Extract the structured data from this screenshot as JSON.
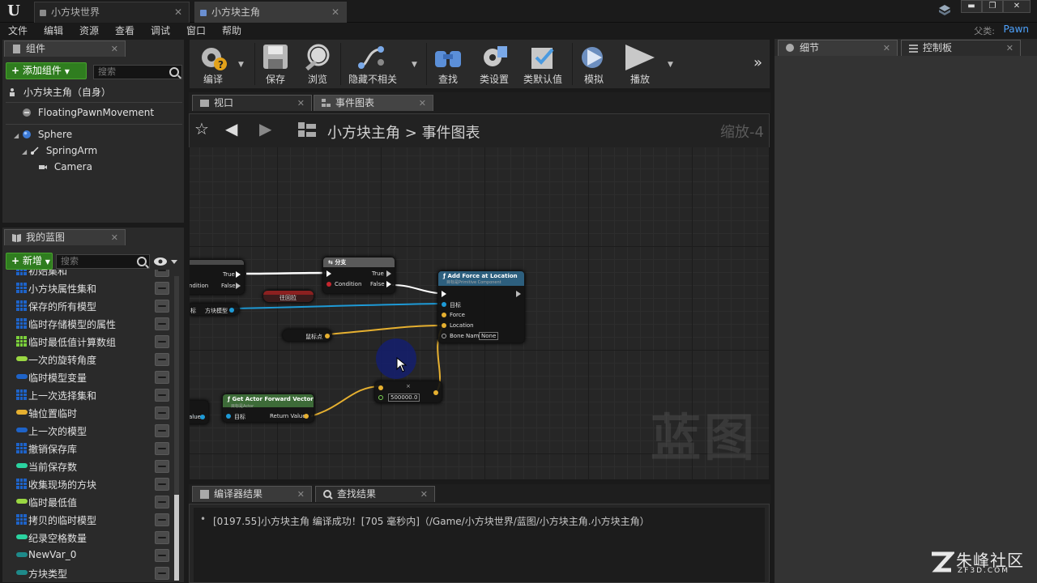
{
  "window": {
    "tabs": [
      {
        "label": "小方块世界",
        "active": false
      },
      {
        "label": "小方块主角",
        "active": true
      }
    ],
    "controls": [
      "▬",
      "❐",
      "✕"
    ]
  },
  "menu": {
    "items": [
      "文件",
      "编辑",
      "资源",
      "查看",
      "调试",
      "窗口",
      "帮助"
    ],
    "parent_label": "父类:",
    "parent_value": "Pawn"
  },
  "components": {
    "tab_label": "组件",
    "add_button": "添加组件",
    "search_placeholder": "搜索",
    "self_label": "小方块主角（自身）",
    "movement_component": "FloatingPawnMovement",
    "tree": [
      {
        "label": "Sphere",
        "icon": "sphere-icon"
      },
      {
        "label": "SpringArm",
        "icon": "springarm-icon"
      },
      {
        "label": "Camera",
        "icon": "camera-icon"
      }
    ]
  },
  "my_blueprint": {
    "tab_label": "我的蓝图",
    "new_button": "新增",
    "search_placeholder": "搜索",
    "variables": [
      {
        "label": "初始集和",
        "color": "#1e63c8",
        "kind": "grid"
      },
      {
        "label": "小方块属性集和",
        "color": "#1e63c8",
        "kind": "grid"
      },
      {
        "label": "保存的所有模型",
        "color": "#1e63c8",
        "kind": "grid"
      },
      {
        "label": "临时存储模型的属性",
        "color": "#1e63c8",
        "kind": "grid"
      },
      {
        "label": "临时最低值计算数组",
        "color": "#7bd03b",
        "kind": "grid"
      },
      {
        "label": "一次的旋转角度",
        "color": "#9ad742",
        "kind": "pill"
      },
      {
        "label": "临时模型变量",
        "color": "#1e63c8",
        "kind": "pill"
      },
      {
        "label": "上一次选择集和",
        "color": "#1e63c8",
        "kind": "grid"
      },
      {
        "label": "轴位置临时",
        "color": "#e6b030",
        "kind": "pill"
      },
      {
        "label": "上一次的模型",
        "color": "#1e63c8",
        "kind": "pill"
      },
      {
        "label": "撤销保存库",
        "color": "#1e63c8",
        "kind": "grid"
      },
      {
        "label": "当前保存数",
        "color": "#2ad3a0",
        "kind": "pill"
      },
      {
        "label": "收集现场的方块",
        "color": "#1e63c8",
        "kind": "grid"
      },
      {
        "label": "临时最低值",
        "color": "#9ad742",
        "kind": "pill"
      },
      {
        "label": "拷贝的临时模型",
        "color": "#1e63c8",
        "kind": "grid"
      },
      {
        "label": "纪录空格数量",
        "color": "#2ad3a0",
        "kind": "pill"
      },
      {
        "label": "NewVar_0",
        "color": "#1e8a8a",
        "kind": "pill"
      },
      {
        "label": "方块类型",
        "color": "#1e8a8a",
        "kind": "pill"
      }
    ]
  },
  "toolbar": {
    "buttons": [
      {
        "label": "编译",
        "icon": "compile-icon"
      },
      {
        "label": "保存",
        "icon": "save-icon"
      },
      {
        "label": "浏览",
        "icon": "browse-icon"
      },
      {
        "label": "隐藏不相关",
        "icon": "hide-unrelated-icon"
      },
      {
        "label": "查找",
        "icon": "find-icon"
      },
      {
        "label": "类设置",
        "icon": "class-settings-icon"
      },
      {
        "label": "类默认值",
        "icon": "class-defaults-icon"
      },
      {
        "label": "模拟",
        "icon": "simulate-icon"
      },
      {
        "label": "播放",
        "icon": "play-icon"
      }
    ]
  },
  "graph": {
    "tabs": [
      "视口",
      "事件图表"
    ],
    "breadcrumb_root": "小方块主角",
    "breadcrumb_separator": ">",
    "breadcrumb_leaf": "事件图表",
    "zoom": "缩放-4",
    "watermark": "蓝图",
    "nodes": {
      "branch_left": {
        "true": "True",
        "false": "False",
        "condition": "ndition"
      },
      "branch": {
        "title": "分支",
        "true": "True",
        "false": "False",
        "condition": "Condition"
      },
      "red_node": "往回拉",
      "var_model": {
        "target": "标",
        "label": "方块模型"
      },
      "mouse_pos": "鼠标点",
      "add_force": {
        "title": "Add Force at Location",
        "subtitle": "目标是Primitive Component",
        "target": "目标",
        "force": "Force",
        "location": "Location",
        "bone_name": "Bone Name",
        "bone_value": "None"
      },
      "forward": {
        "title": "Get Actor Forward Vector",
        "subtitle": "目标是Actor",
        "target": "目标",
        "return": "Return Value",
        "left_value": "alue"
      },
      "multiply": {
        "value": "500000.0",
        "op": "×"
      }
    }
  },
  "output": {
    "tabs": [
      "编译器结果",
      "查找结果"
    ],
    "bullet": "•",
    "line": "[0197.55]小方块主角 编译成功！[705 毫秒内]（/Game/小方块世界/蓝图/小方块主角.小方块主角）"
  },
  "details": {
    "tabs": [
      "细节",
      "控制板"
    ]
  },
  "site": {
    "name": "朱峰社区",
    "url": "ZF3D.COM"
  },
  "colors": {
    "accent_blue": "#4ea3ff",
    "green_button": "#2f7d1f",
    "exec_wire": "#ffffff",
    "vector_wire": "#e6b030",
    "object_wire": "#1e9ad6"
  }
}
